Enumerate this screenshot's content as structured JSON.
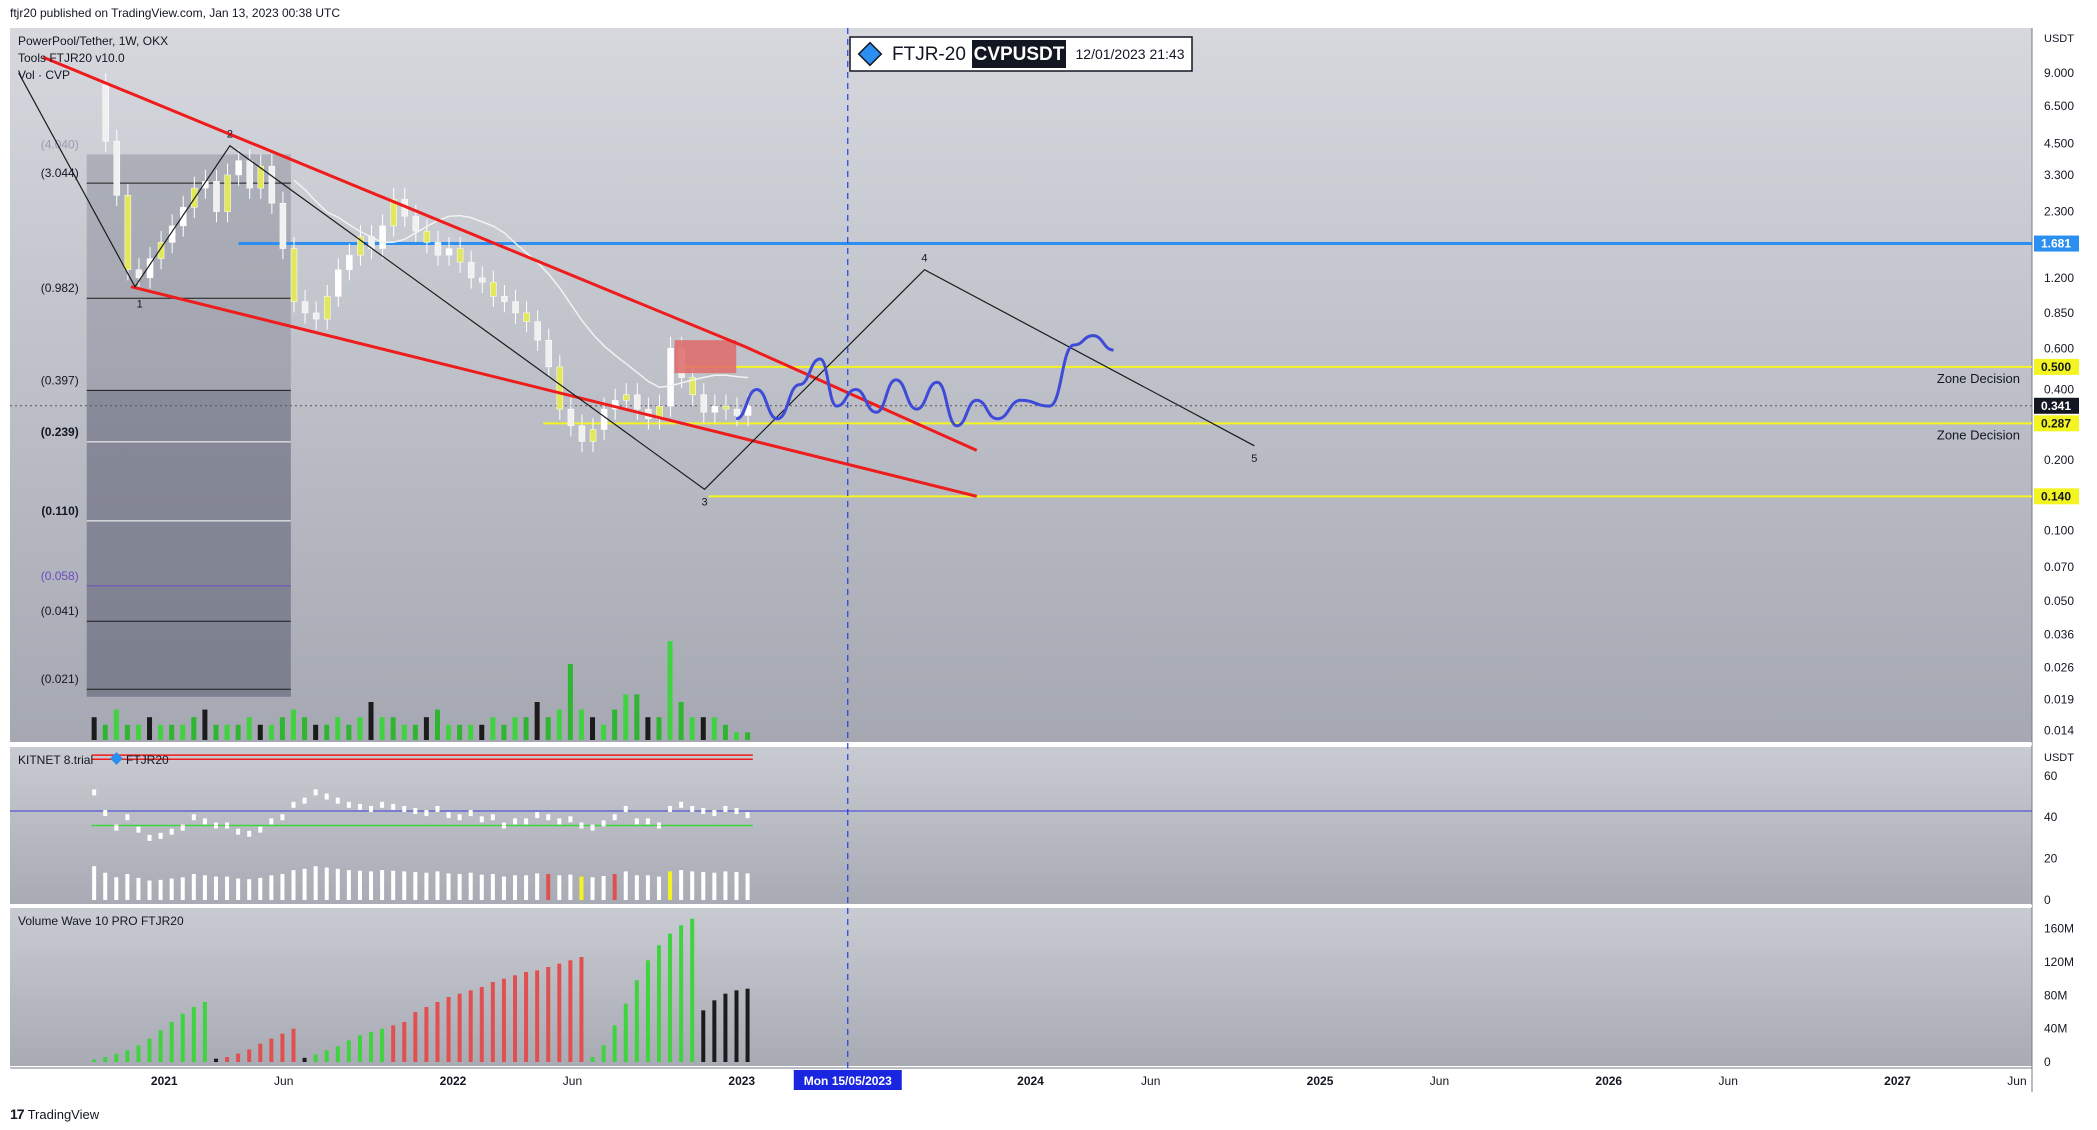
{
  "header": {
    "published": "ftjr20 published on TradingView.com, Jan 13, 2023 00:38 UTC",
    "footer_brand": "TradingView",
    "footer_logo": "17"
  },
  "legend": {
    "line1": "PowerPool/Tether, 1W, OKX",
    "line2": "Tools  FTJR20  v10.0",
    "line3": "Vol · CVP"
  },
  "badge": {
    "brand": "FTJR-20",
    "pair": "CVPUSDT",
    "datetime": "12/01/2023 21:43"
  },
  "colors": {
    "panel_bg": "#b8bac3",
    "channel_red": "#ee1c1c",
    "wave_blue": "#3d4bd6",
    "zone_yellow": "#f3f520",
    "level_blue": "#2a8ff0",
    "cursor_blue": "#1f3fe6",
    "up_green": "#3fd33f",
    "down_red": "#e05050"
  },
  "chart_data": [
    {
      "type": "line",
      "name": "price",
      "title": "PowerPool/Tether, 1W, OKX",
      "y_unit": "USDT",
      "y_scale": "log",
      "y_ticks": [
        "9.000",
        "6.500",
        "4.500",
        "3.300",
        "2.300",
        "1.200",
        "0.850",
        "0.600",
        "0.400",
        "0.200",
        "0.100",
        "0.070",
        "0.050",
        "0.036",
        "0.026",
        "0.019",
        "0.014"
      ],
      "y_tick_values": [
        9.0,
        6.5,
        4.5,
        3.3,
        2.3,
        1.2,
        0.85,
        0.6,
        0.4,
        0.2,
        0.1,
        0.07,
        0.05,
        0.036,
        0.026,
        0.019,
        0.014
      ],
      "ylim": [
        0.0125,
        14.0
      ],
      "x_ticks": [
        "2021",
        "Jun",
        "2022",
        "Jun",
        "2023",
        "2024",
        "Jun",
        "2025",
        "Jun",
        "2026",
        "Jun",
        "2027",
        "Jun"
      ],
      "x_tick_dates": [
        "2021-01-01",
        "2021-06-01",
        "2022-01-01",
        "2022-06-01",
        "2023-01-01",
        "2024-01-01",
        "2024-06-01",
        "2025-01-01",
        "2025-06-01",
        "2026-01-01",
        "2026-06-01",
        "2027-01-01",
        "2027-06-01"
      ],
      "xlim": [
        "2020-06-20",
        "2027-06-20"
      ],
      "cursor_date_label": "Mon 15/05/2023",
      "cursor_date": "2023-05-15",
      "price_tags": [
        {
          "label": "1.681",
          "value": 1.681,
          "kind": "level"
        },
        {
          "label": "0.500",
          "value": 0.5,
          "kind": "zone"
        },
        {
          "label": "0.341",
          "value": 0.341,
          "kind": "last"
        },
        {
          "label": "0.287",
          "value": 0.287,
          "kind": "zone"
        },
        {
          "label": "0.140",
          "value": 0.14,
          "kind": "zone"
        }
      ],
      "fib_levels": [
        {
          "label": "(4.040)",
          "value": 4.04,
          "faded": true
        },
        {
          "label": "(3.044)",
          "value": 3.044
        },
        {
          "label": "(0.982)",
          "value": 0.982
        },
        {
          "label": "(0.397)",
          "value": 0.397
        },
        {
          "label": "(0.239)",
          "value": 0.239,
          "bold": true
        },
        {
          "label": "(0.110)",
          "value": 0.11,
          "bold": true
        },
        {
          "label": "(0.058)",
          "value": 0.058,
          "purple": true
        },
        {
          "label": "(0.041)",
          "value": 0.041
        },
        {
          "label": "(0.021)",
          "value": 0.021
        }
      ],
      "zones": [
        {
          "label": "Zone Decision",
          "value": 0.5
        },
        {
          "label": "Zone Decision",
          "value": 0.287
        }
      ],
      "wave_labels": [
        {
          "label": "1",
          "date": "2020-12-01",
          "value": 1.05
        },
        {
          "label": "2",
          "date": "2021-03-25",
          "value": 4.4
        },
        {
          "label": "3",
          "date": "2022-11-15",
          "value": 0.15
        },
        {
          "label": "4",
          "date": "2023-08-20",
          "value": 1.3
        },
        {
          "label": "5",
          "date": "2024-10-10",
          "value": 0.23
        }
      ],
      "wave_path": [
        {
          "date": "2020-07-01",
          "value": 9.0
        },
        {
          "date": "2020-11-25",
          "value": 1.1
        },
        {
          "date": "2021-03-25",
          "value": 4.4
        },
        {
          "date": "2022-11-15",
          "value": 0.15
        },
        {
          "date": "2023-08-20",
          "value": 1.3
        },
        {
          "date": "2024-10-10",
          "value": 0.23
        }
      ],
      "channel_upper": [
        {
          "date": "2020-08-01",
          "value": 10.5
        },
        {
          "date": "2023-01-05",
          "value": 0.61
        },
        {
          "date": "2023-10-25",
          "value": 0.22
        }
      ],
      "channel_lower": [
        {
          "date": "2020-11-20",
          "value": 1.1
        },
        {
          "date": "2023-10-25",
          "value": 0.14
        }
      ],
      "projection_path": [
        {
          "date": "2022-12-25",
          "value": 0.3
        },
        {
          "date": "2023-01-20",
          "value": 0.4
        },
        {
          "date": "2023-02-15",
          "value": 0.3
        },
        {
          "date": "2023-03-15",
          "value": 0.42
        },
        {
          "date": "2023-04-10",
          "value": 0.54
        },
        {
          "date": "2023-05-01",
          "value": 0.34
        },
        {
          "date": "2023-05-25",
          "value": 0.4
        },
        {
          "date": "2023-06-20",
          "value": 0.32
        },
        {
          "date": "2023-07-15",
          "value": 0.44
        },
        {
          "date": "2023-08-10",
          "value": 0.33
        },
        {
          "date": "2023-09-05",
          "value": 0.43
        },
        {
          "date": "2023-09-30",
          "value": 0.28
        },
        {
          "date": "2023-10-25",
          "value": 0.36
        },
        {
          "date": "2023-11-20",
          "value": 0.3
        },
        {
          "date": "2023-12-20",
          "value": 0.36
        },
        {
          "date": "2024-01-25",
          "value": 0.34
        },
        {
          "date": "2024-02-25",
          "value": 0.62
        },
        {
          "date": "2024-03-20",
          "value": 0.68
        },
        {
          "date": "2024-04-15",
          "value": 0.59
        }
      ],
      "series": [
        {
          "name": "CVPUSDT",
          "values": [
            {
              "date": "2020-10-05",
              "value": 8.0
            },
            {
              "date": "2020-10-19",
              "value": 4.6
            },
            {
              "date": "2020-11-02",
              "value": 2.7
            },
            {
              "date": "2020-11-16",
              "value": 1.3
            },
            {
              "date": "2020-11-30",
              "value": 1.2
            },
            {
              "date": "2020-12-14",
              "value": 1.45
            },
            {
              "date": "2020-12-28",
              "value": 1.7
            },
            {
              "date": "2021-01-11",
              "value": 2.0
            },
            {
              "date": "2021-01-25",
              "value": 2.4
            },
            {
              "date": "2021-02-08",
              "value": 2.9
            },
            {
              "date": "2021-02-22",
              "value": 3.1
            },
            {
              "date": "2021-03-08",
              "value": 2.3
            },
            {
              "date": "2021-03-22",
              "value": 3.3
            },
            {
              "date": "2021-04-05",
              "value": 3.8
            },
            {
              "date": "2021-04-19",
              "value": 2.9
            },
            {
              "date": "2021-05-03",
              "value": 3.6
            },
            {
              "date": "2021-05-17",
              "value": 2.5
            },
            {
              "date": "2021-05-31",
              "value": 1.6
            },
            {
              "date": "2021-06-14",
              "value": 0.95
            },
            {
              "date": "2021-06-28",
              "value": 0.85
            },
            {
              "date": "2021-07-12",
              "value": 0.8
            },
            {
              "date": "2021-07-26",
              "value": 1.0
            },
            {
              "date": "2021-08-09",
              "value": 1.3
            },
            {
              "date": "2021-08-23",
              "value": 1.5
            },
            {
              "date": "2021-09-06",
              "value": 1.8
            },
            {
              "date": "2021-09-20",
              "value": 1.6
            },
            {
              "date": "2021-10-04",
              "value": 2.0
            },
            {
              "date": "2021-10-18",
              "value": 2.6
            },
            {
              "date": "2021-11-01",
              "value": 2.2
            },
            {
              "date": "2021-11-15",
              "value": 1.9
            },
            {
              "date": "2021-11-29",
              "value": 1.7
            },
            {
              "date": "2021-12-13",
              "value": 1.5
            },
            {
              "date": "2021-12-27",
              "value": 1.6
            },
            {
              "date": "2022-01-10",
              "value": 1.4
            },
            {
              "date": "2022-01-24",
              "value": 1.2
            },
            {
              "date": "2022-02-07",
              "value": 1.15
            },
            {
              "date": "2022-02-21",
              "value": 1.0
            },
            {
              "date": "2022-03-07",
              "value": 0.95
            },
            {
              "date": "2022-03-21",
              "value": 0.85
            },
            {
              "date": "2022-04-04",
              "value": 0.78
            },
            {
              "date": "2022-04-18",
              "value": 0.65
            },
            {
              "date": "2022-05-02",
              "value": 0.5
            },
            {
              "date": "2022-05-16",
              "value": 0.33
            },
            {
              "date": "2022-05-30",
              "value": 0.28
            },
            {
              "date": "2022-06-13",
              "value": 0.24
            },
            {
              "date": "2022-06-27",
              "value": 0.27
            },
            {
              "date": "2022-07-11",
              "value": 0.33
            },
            {
              "date": "2022-07-25",
              "value": 0.36
            },
            {
              "date": "2022-08-08",
              "value": 0.38
            },
            {
              "date": "2022-08-22",
              "value": 0.33
            },
            {
              "date": "2022-09-05",
              "value": 0.3
            },
            {
              "date": "2022-09-19",
              "value": 0.34
            },
            {
              "date": "2022-10-03",
              "value": 0.6
            },
            {
              "date": "2022-10-17",
              "value": 0.45
            },
            {
              "date": "2022-10-31",
              "value": 0.38
            },
            {
              "date": "2022-11-14",
              "value": 0.32
            },
            {
              "date": "2022-11-28",
              "value": 0.34
            },
            {
              "date": "2022-12-12",
              "value": 0.33
            },
            {
              "date": "2022-12-26",
              "value": 0.31
            },
            {
              "date": "2023-01-09",
              "value": 0.341
            }
          ]
        }
      ]
    },
    {
      "type": "bar",
      "name": "volume",
      "title": "Vol · CVP",
      "values": [
        3,
        2,
        4,
        2,
        2,
        3,
        2,
        2,
        2,
        3,
        4,
        2,
        2,
        2,
        3,
        2,
        2,
        3,
        4,
        3,
        2,
        2,
        3,
        2,
        3,
        5,
        3,
        3,
        2,
        2,
        3,
        4,
        2,
        2,
        2,
        2,
        3,
        2,
        3,
        3,
        5,
        3,
        4,
        10,
        4,
        3,
        2,
        4,
        6,
        6,
        3,
        3,
        13,
        5,
        3,
        3,
        3,
        2,
        1,
        1
      ]
    },
    {
      "type": "bar",
      "name": "KITNET",
      "title": "KITNET  8.trial",
      "badge": "FTJR20",
      "y_unit": "USDT",
      "y_ticks": [
        "60",
        "40",
        "20",
        "0"
      ],
      "y_tick_values": [
        60,
        40,
        20,
        0
      ],
      "ylim": [
        0,
        72
      ],
      "ref_lines": [
        70,
        68,
        36
      ],
      "hline": 43,
      "values": [
        52,
        42,
        35,
        40,
        34,
        30,
        31,
        33,
        35,
        40,
        38,
        36,
        36,
        33,
        32,
        34,
        38,
        40,
        46,
        48,
        52,
        50,
        48,
        46,
        45,
        44,
        46,
        45,
        44,
        43,
        42,
        44,
        41,
        40,
        42,
        39,
        40,
        36,
        38,
        38,
        41,
        40,
        38,
        39,
        36,
        35,
        37,
        40,
        44,
        38,
        38,
        36,
        44,
        46,
        44,
        43,
        42,
        44,
        43,
        41
      ]
    },
    {
      "type": "bar",
      "name": "Volume Wave",
      "title": "Volume Wave 10 PRO FTJR20",
      "y_ticks": [
        "160M",
        "120M",
        "80M",
        "40M",
        "0"
      ],
      "y_tick_values": [
        160,
        120,
        80,
        40,
        0
      ],
      "ylim": [
        0,
        180
      ],
      "values": [
        3,
        6,
        10,
        14,
        20,
        28,
        38,
        48,
        58,
        66,
        72,
        4,
        6,
        10,
        15,
        22,
        28,
        34,
        40,
        5,
        9,
        14,
        19,
        26,
        32,
        36,
        40,
        44,
        48,
        60,
        66,
        72,
        78,
        82,
        86,
        90,
        96,
        100,
        104,
        108,
        110,
        114,
        118,
        122,
        126,
        6,
        20,
        44,
        70,
        98,
        122,
        140,
        154,
        164,
        172,
        62,
        74,
        82,
        86,
        88
      ],
      "colors": [
        "g",
        "g",
        "g",
        "g",
        "g",
        "g",
        "g",
        "g",
        "g",
        "g",
        "g",
        "k",
        "r",
        "r",
        "r",
        "r",
        "r",
        "r",
        "r",
        "k",
        "g",
        "g",
        "g",
        "g",
        "g",
        "g",
        "g",
        "r",
        "r",
        "r",
        "r",
        "r",
        "r",
        "r",
        "r",
        "r",
        "r",
        "r",
        "r",
        "r",
        "r",
        "r",
        "r",
        "r",
        "r",
        "g",
        "g",
        "g",
        "g",
        "g",
        "g",
        "g",
        "g",
        "g",
        "g",
        "k",
        "k",
        "k",
        "k",
        "k"
      ]
    }
  ]
}
